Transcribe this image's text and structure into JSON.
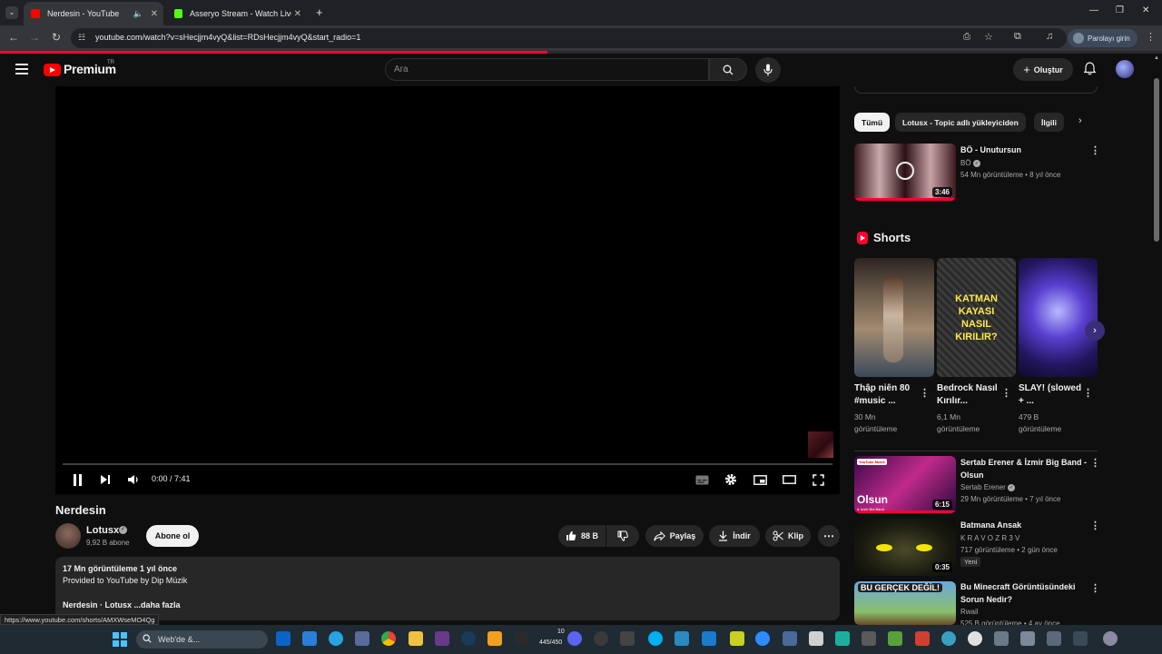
{
  "browser": {
    "tabs": [
      {
        "title": "Nerdesin - YouTube",
        "active": true
      },
      {
        "title": "Asseryo Stream - Watch Live on",
        "active": false
      }
    ],
    "url": "youtube.com/watch?v=sHecjjm4vyQ&list=RDsHecjjm4vyQ&start_radio=1",
    "signin_label": "Parolayı girin",
    "status_url": "https://www.youtube.com/shorts/AMXWseMO4Qg"
  },
  "header": {
    "logo_text": "Premium",
    "logo_region": "TR",
    "search_placeholder": "Ara",
    "create_label": "Oluştur"
  },
  "player": {
    "time": "0:00 / 7:41"
  },
  "video": {
    "title": "Nerdesin",
    "channel": "Lotusx",
    "subscribers": "9,92 B abone",
    "subscribe_label": "Abone ol",
    "likes": "88 B",
    "share_label": "Paylaş",
    "download_label": "İndir",
    "clip_label": "Klip",
    "description": {
      "stats": "17 Mn görüntüleme  1 yıl önce",
      "line1": "Provided to YouTube by Dip Müzik",
      "line2": "Nerdesin · Lotusx ...daha fazla"
    }
  },
  "sidebar": {
    "chips": [
      "Tümü",
      "Lotusx - Topic adlı yükleyiciden",
      "İlgili"
    ],
    "top_video": {
      "title": "BÖ - Unutursun",
      "channel": "BÖ",
      "meta": "54 Mn görüntüleme • 8 yıl önce",
      "duration": "3:46"
    },
    "shorts_title": "Shorts",
    "shorts": [
      {
        "title": "Thập niên 80 #music ...",
        "views": "30 Mn",
        "views_label": "görüntüleme"
      },
      {
        "title": "Bedrock Nasıl Kırılır...",
        "views": "6,1 Mn",
        "views_label": "görüntüleme",
        "thumb_text": "KATMAN KAYASI NASIL KIRILIR?"
      },
      {
        "title": "SLAY! (slowed + ...",
        "views": "479 B",
        "views_label": "görüntüleme"
      }
    ],
    "videos": [
      {
        "title": "Sertab Erener & İzmir Big Band - Olsun",
        "channel": "Sertab Erener",
        "meta": "29 Mn görüntüleme • 7 yıl önce",
        "duration": "6:15",
        "thumb_text": "Olsun",
        "thumb_sub": "& İzmir Big Band",
        "badge": "YouTube Music"
      },
      {
        "title": "Batmana Ansak",
        "channel": "K R A V O Z R 3 V",
        "meta": "717 görüntüleme • 2 gün önce",
        "duration": "0:35",
        "tag": "Yeni"
      },
      {
        "title": "Bu Minecraft Görüntüsündeki Sorun Nedir?",
        "channel": "Rwail",
        "meta": "525 B görüntüleme • 4 ay önce",
        "thumb_text": "BU GERÇEK DEĞİL!"
      }
    ]
  },
  "taskbar": {
    "search_placeholder": "Web'de &...",
    "counter": "445/450",
    "counter_top": "10"
  }
}
